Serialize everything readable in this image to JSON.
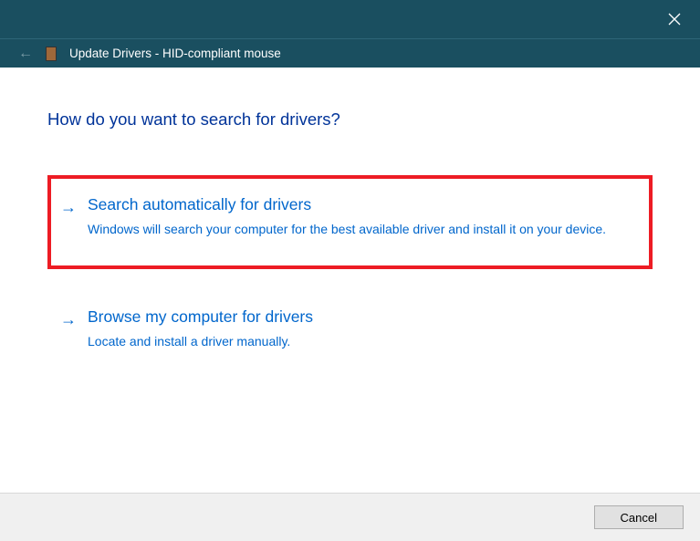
{
  "titlebar": {
    "close_label": "Close"
  },
  "header": {
    "title": "Update Drivers - HID-compliant mouse"
  },
  "page": {
    "title": "How do you want to search for drivers?"
  },
  "options": [
    {
      "title": "Search automatically for drivers",
      "description": "Windows will search your computer for the best available driver and install it on your device.",
      "highlighted": true
    },
    {
      "title": "Browse my computer for drivers",
      "description": "Locate and install a driver manually.",
      "highlighted": false
    }
  ],
  "footer": {
    "cancel_label": "Cancel"
  },
  "colors": {
    "titlebar_bg": "#1a4f60",
    "link": "#0066cc",
    "heading": "#003399",
    "highlight_border": "#ed1c24",
    "footer_bg": "#f0f0f0"
  }
}
